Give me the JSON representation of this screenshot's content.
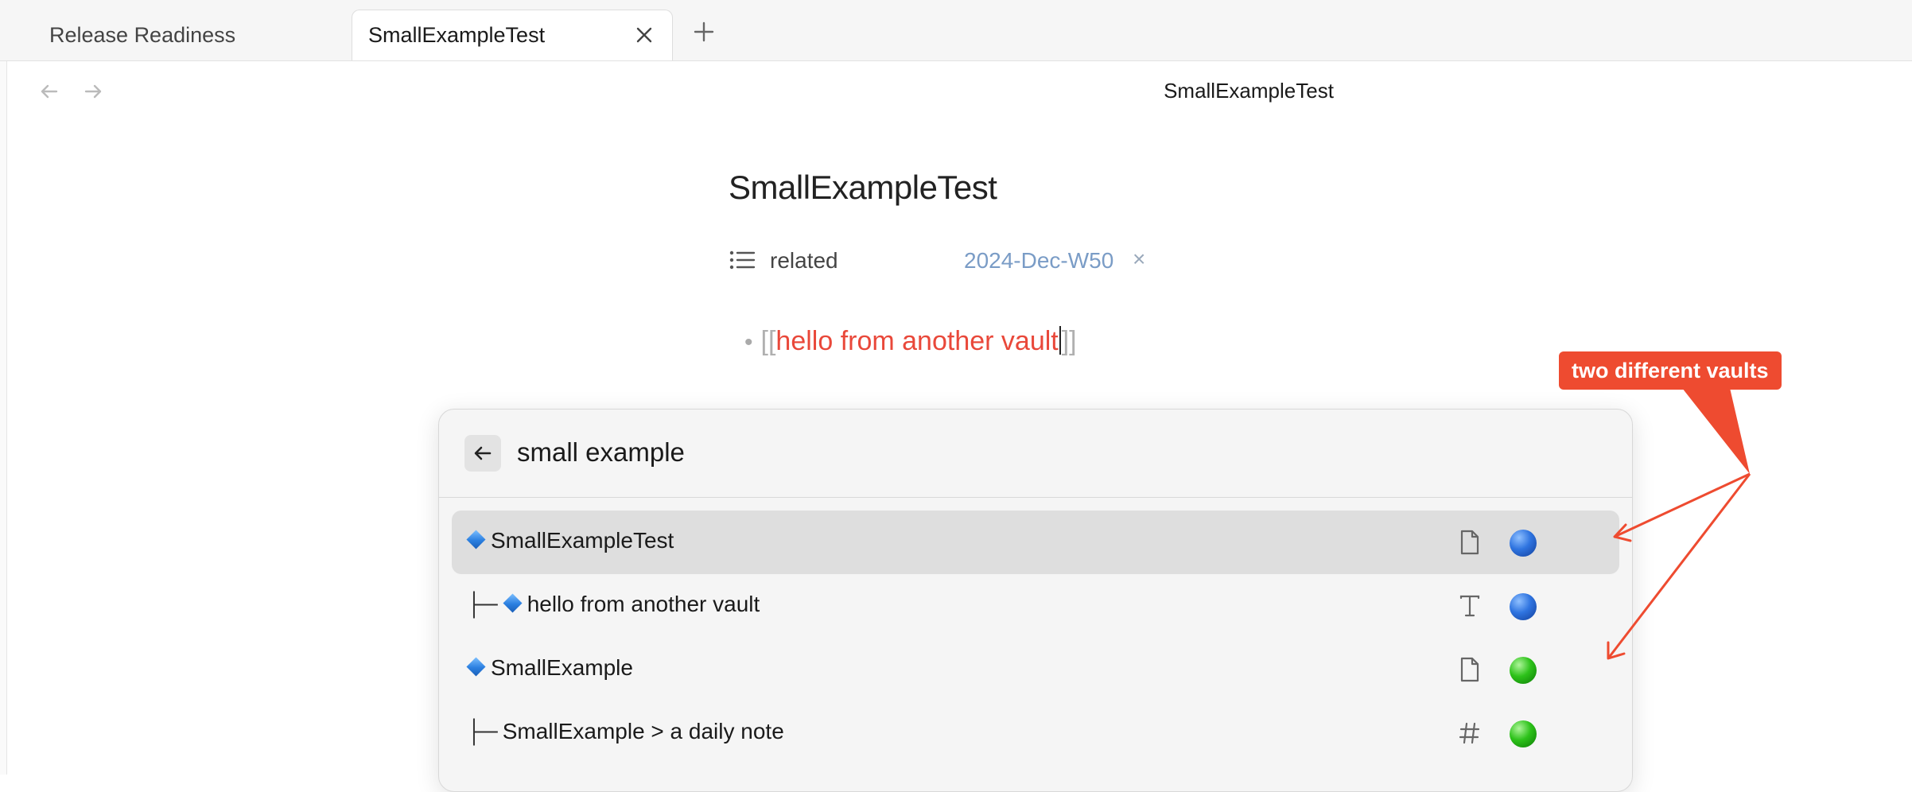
{
  "tabs": [
    {
      "label": "Release Readiness",
      "active": false
    },
    {
      "label": "SmallExampleTest",
      "active": true
    }
  ],
  "nav": {
    "view_title": "SmallExampleTest"
  },
  "note": {
    "title": "SmallExampleTest",
    "property": {
      "key": "related",
      "value": "2024-Dec-W50",
      "icon": "list-icon"
    },
    "bullet": {
      "open": "[[",
      "link": "hello from another vault",
      "close": "]]"
    }
  },
  "switcher": {
    "query": "small example",
    "items": [
      {
        "prefix": "",
        "diamond": true,
        "label": "SmallExampleTest",
        "type_icon": "file-icon",
        "vault_color": "blue",
        "selected": true
      },
      {
        "prefix": "├─",
        "diamond": true,
        "label": "hello from another vault",
        "type_icon": "text-icon",
        "vault_color": "blue",
        "selected": false
      },
      {
        "prefix": "",
        "diamond": true,
        "label": "SmallExample",
        "type_icon": "file-icon",
        "vault_color": "green",
        "selected": false
      },
      {
        "prefix": "├─",
        "diamond": false,
        "label": "SmallExample > a daily note",
        "type_icon": "hash-icon",
        "vault_color": "green",
        "selected": false
      }
    ]
  },
  "annotation": {
    "label": "two different vaults",
    "color": "#ee4b30"
  },
  "colors": {
    "link": "#e9483a",
    "property_value": "#7a9cc6",
    "vault_blue": "#2f74e0",
    "vault_green": "#2dc21a"
  }
}
